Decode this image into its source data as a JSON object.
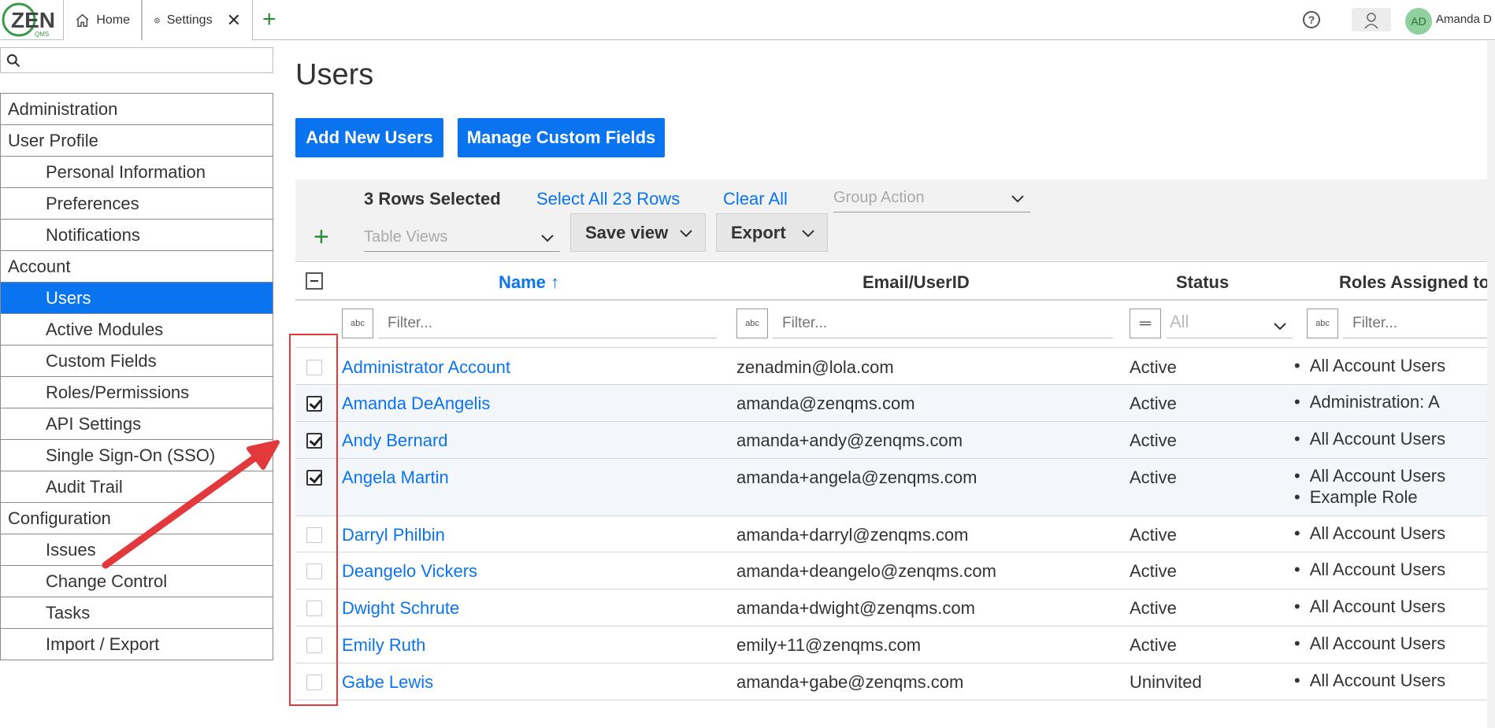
{
  "app": {
    "logo_text": "ZEN",
    "logo_sub": "QMS"
  },
  "tabs": [
    {
      "label": "Home",
      "icon": "home-icon"
    },
    {
      "label": "Settings",
      "icon": "gear-icon"
    }
  ],
  "header": {
    "help_icon": "question-icon",
    "avatar_initials": "AD",
    "user_name": "Amanda D"
  },
  "sidebar": {
    "search_placeholder": "",
    "sections": [
      {
        "label": "Administration"
      },
      {
        "label": "User Profile",
        "items": [
          "Personal Information",
          "Preferences",
          "Notifications"
        ]
      },
      {
        "label": "Account",
        "items": [
          "Users",
          "Active Modules",
          "Custom Fields",
          "Roles/Permissions",
          "API Settings",
          "Single Sign-On (SSO)",
          "Audit Trail"
        ],
        "active": "Users"
      },
      {
        "label": "Configuration",
        "items": [
          "Issues",
          "Change Control",
          "Tasks",
          "Import / Export"
        ]
      }
    ]
  },
  "page": {
    "title": "Users",
    "add_button": "Add New Users",
    "manage_button": "Manage Custom Fields"
  },
  "toolbar": {
    "rows_selected": "3 Rows Selected",
    "select_all": "Select All 23 Rows",
    "clear_all": "Clear All",
    "group_action_placeholder": "Group Action",
    "table_views_placeholder": "Table Views",
    "save_view": "Save view",
    "export": "Export"
  },
  "table": {
    "columns": [
      "Name ↑",
      "Email/UserID",
      "Status",
      "Roles Assigned to"
    ],
    "filter_placeholder": "Filter...",
    "status_filter_value": "All",
    "filter_type_text": "abc",
    "rows": [
      {
        "name": "Administrator Account",
        "email": "zenadmin@lola.com",
        "status": "Active",
        "roles": [
          "All Account Users"
        ],
        "checked": false
      },
      {
        "name": "Amanda DeAngelis",
        "email": "amanda@zenqms.com",
        "status": "Active",
        "roles": [
          "Administration: A"
        ],
        "checked": true
      },
      {
        "name": "Andy Bernard",
        "email": "amanda+andy@zenqms.com",
        "status": "Active",
        "roles": [
          "All Account Users"
        ],
        "checked": true
      },
      {
        "name": "Angela Martin",
        "email": "amanda+angela@zenqms.com",
        "status": "Active",
        "roles": [
          "All Account Users",
          "Example Role"
        ],
        "checked": true
      },
      {
        "name": "Darryl Philbin",
        "email": "amanda+darryl@zenqms.com",
        "status": "Active",
        "roles": [
          "All Account Users"
        ],
        "checked": false
      },
      {
        "name": "Deangelo Vickers",
        "email": "amanda+deangelo@zenqms.com",
        "status": "Active",
        "roles": [
          "All Account Users"
        ],
        "checked": false
      },
      {
        "name": "Dwight Schrute",
        "email": "amanda+dwight@zenqms.com",
        "status": "Active",
        "roles": [
          "All Account Users"
        ],
        "checked": false
      },
      {
        "name": "Emily Ruth",
        "email": "emily+11@zenqms.com",
        "status": "Active",
        "roles": [
          "All Account Users"
        ],
        "checked": false
      },
      {
        "name": "Gabe Lewis",
        "email": "amanda+gabe@zenqms.com",
        "status": "Uninvited",
        "roles": [
          "All Account Users"
        ],
        "checked": false
      }
    ]
  },
  "colors": {
    "accent": "#0a74f0",
    "highlight": "#fcf84a",
    "annotation": "#e2393c",
    "add_green": "#2e8b3a"
  }
}
